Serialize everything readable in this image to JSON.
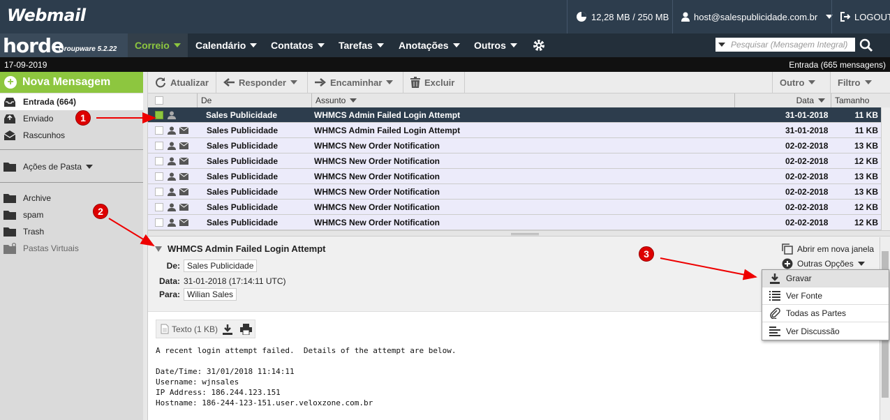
{
  "topbar": {
    "logo": "Webmail",
    "quota": "12,28 MB / 250 MB",
    "user": "host@salespublicidade.com.br",
    "logout": "LOGOUT"
  },
  "navbar": {
    "brand": "horde",
    "brand_sub": "Groupware 5.2.22",
    "menus": [
      "Correio",
      "Calendário",
      "Contatos",
      "Tarefas",
      "Anotações",
      "Outros"
    ],
    "search_placeholder": "Pesquisar (Mensagem Integral)"
  },
  "statusbar": {
    "date": "17-09-2019",
    "folder_info": "Entrada (665 mensagens)"
  },
  "sidebar": {
    "new_message": "Nova Mensagem",
    "inbox": "Entrada (664)",
    "sent": "Enviado",
    "drafts": "Rascunhos",
    "folder_actions": "Ações de Pasta",
    "archive": "Archive",
    "spam": "spam",
    "trash": "Trash",
    "virtual": "Pastas Virtuais"
  },
  "toolbar": {
    "refresh": "Atualizar",
    "reply": "Responder",
    "forward": "Encaminhar",
    "delete": "Excluir",
    "other": "Outro",
    "filter": "Filtro"
  },
  "list": {
    "columns": {
      "from": "De",
      "subject": "Assunto",
      "date": "Data",
      "size": "Tamanho"
    },
    "rows": [
      {
        "from": "Sales Publicidade",
        "subject": "WHMCS Admin Failed Login Attempt",
        "date": "31-01-2018",
        "size": "11 KB"
      },
      {
        "from": "Sales Publicidade",
        "subject": "WHMCS Admin Failed Login Attempt",
        "date": "31-01-2018",
        "size": "11 KB"
      },
      {
        "from": "Sales Publicidade",
        "subject": "WHMCS New Order Notification",
        "date": "02-02-2018",
        "size": "13 KB"
      },
      {
        "from": "Sales Publicidade",
        "subject": "WHMCS New Order Notification",
        "date": "02-02-2018",
        "size": "12 KB"
      },
      {
        "from": "Sales Publicidade",
        "subject": "WHMCS New Order Notification",
        "date": "02-02-2018",
        "size": "13 KB"
      },
      {
        "from": "Sales Publicidade",
        "subject": "WHMCS New Order Notification",
        "date": "02-02-2018",
        "size": "13 KB"
      },
      {
        "from": "Sales Publicidade",
        "subject": "WHMCS New Order Notification",
        "date": "02-02-2018",
        "size": "12 KB"
      },
      {
        "from": "Sales Publicidade",
        "subject": "WHMCS New Order Notification",
        "date": "02-02-2018",
        "size": "12 KB"
      }
    ]
  },
  "preview": {
    "subject": "WHMCS Admin Failed Login Attempt",
    "from_label": "De:",
    "from": "Sales Publicidade",
    "date_label": "Data:",
    "date": "31-01-2018 (17:14:11 UTC)",
    "to_label": "Para:",
    "to": "Wilian Sales",
    "open_new": "Abrir em nova janela",
    "more_options": "Outras Opções",
    "attachment": "Texto (1 KB)",
    "body_lines": [
      "A recent login attempt failed.  Details of the attempt are below.",
      "",
      "Date/Time: 31/01/2018 11:14:11",
      "Username: wjnsales",
      "IP Address: 186.244.123.151",
      "Hostname: 186-244-123-151.user.veloxzone.com.br"
    ]
  },
  "dropdown": {
    "items": [
      "Gravar",
      "Ver Fonte",
      "Todas as Partes",
      "Ver Discussão"
    ]
  },
  "annotations": {
    "one": "1",
    "two": "2",
    "three": "3"
  },
  "colors": {
    "accent": "#8dc63f",
    "topbar": "#2d3d4d",
    "annotation": "#dd0000"
  }
}
